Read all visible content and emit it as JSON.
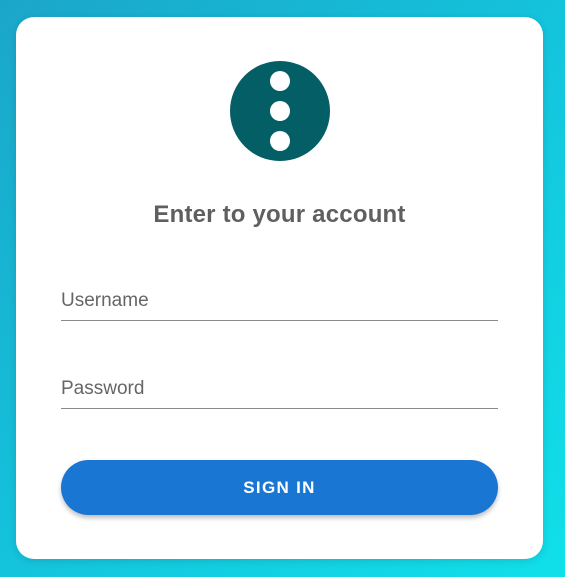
{
  "login": {
    "title": "Enter to your account",
    "username": {
      "placeholder": "Username",
      "value": ""
    },
    "password": {
      "placeholder": "Password",
      "value": ""
    },
    "submit_label": "SIGN IN"
  },
  "logo": {
    "icon": "more-vert-icon",
    "color": "#035e66"
  },
  "colors": {
    "primary_button": "#1976d2",
    "title_text": "#5f5f5f"
  }
}
